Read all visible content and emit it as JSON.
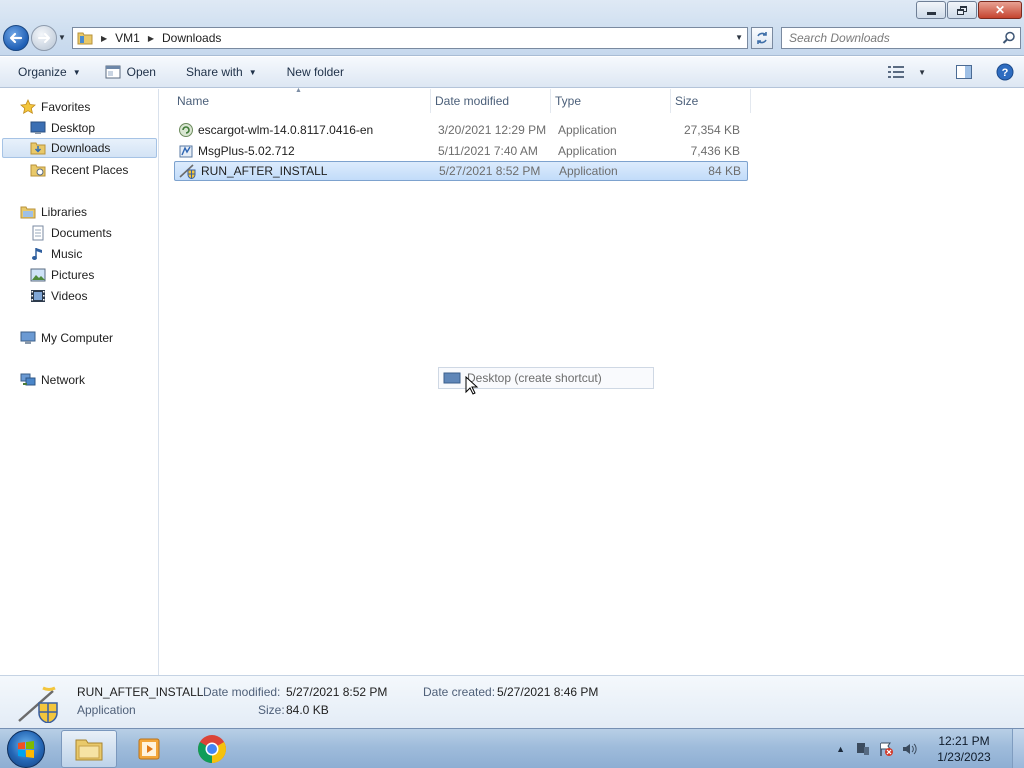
{
  "window": {
    "minimize_icon": "minimize-icon",
    "maximize_icon": "restore-icon",
    "close_icon": "close-icon"
  },
  "address": {
    "breadcrumbs": [
      "VM1",
      "Downloads"
    ],
    "search_placeholder": "Search Downloads"
  },
  "toolbar": {
    "organize": "Organize",
    "open": "Open",
    "share_with": "Share with",
    "new_folder": "New folder"
  },
  "nav": {
    "favorites": "Favorites",
    "desktop": "Desktop",
    "downloads": "Downloads",
    "recent_places": "Recent Places",
    "libraries": "Libraries",
    "documents": "Documents",
    "music": "Music",
    "pictures": "Pictures",
    "videos": "Videos",
    "my_computer": "My Computer",
    "network": "Network"
  },
  "columns": {
    "name": "Name",
    "date_modified": "Date modified",
    "type": "Type",
    "size": "Size"
  },
  "files": [
    {
      "name": "escargot-wlm-14.0.8117.0416-en",
      "date": "3/20/2021 12:29 PM",
      "type": "Application",
      "size": "27,354 KB",
      "icon": "escargot-installer-icon"
    },
    {
      "name": "MsgPlus-5.02.712",
      "date": "5/11/2021 7:40 AM",
      "type": "Application",
      "size": "7,436 KB",
      "icon": "msgplus-installer-icon"
    },
    {
      "name": "RUN_AFTER_INSTALL",
      "date": "5/27/2021 8:52 PM",
      "type": "Application",
      "size": "84 KB",
      "icon": "shield-app-icon",
      "selected": true
    }
  ],
  "drag_tooltip": "Desktop (create shortcut)",
  "details": {
    "name": "RUN_AFTER_INSTALL",
    "kind": "Application",
    "date_modified_label": "Date modified:",
    "date_modified": "5/27/2021 8:52 PM",
    "size_label": "Size:",
    "size": "84.0 KB",
    "date_created_label": "Date created:",
    "date_created": "5/27/2021 8:46 PM"
  },
  "taskbar": {
    "time": "12:21 PM",
    "date": "1/23/2023"
  }
}
